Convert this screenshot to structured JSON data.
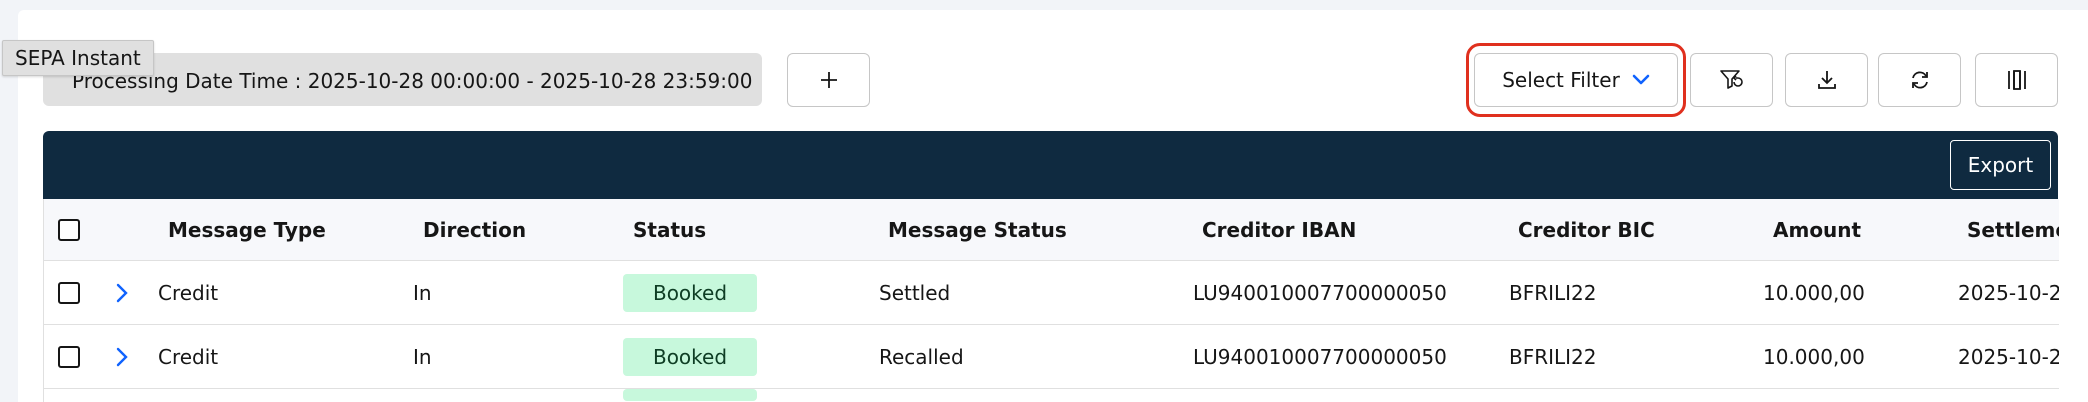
{
  "tooltip": "SEPA Instant",
  "filter_chip": "Processing Date Time : 2025-10-28 00:00:00 - 2025-10-28 23:59:00",
  "toolbar": {
    "add_icon": "plus-icon",
    "select_filter_label": "Select Filter",
    "icons": [
      "filter-reset-icon",
      "download-icon",
      "refresh-icon",
      "columns-icon"
    ]
  },
  "table": {
    "export_label": "Export",
    "columns": [
      "Message Type",
      "Direction",
      "Status",
      "Message Status",
      "Creditor IBAN",
      "Creditor BIC",
      "Amount",
      "Settleme"
    ],
    "rows": [
      {
        "message_type": "Credit",
        "direction": "In",
        "status": "Booked",
        "message_status": "Settled",
        "creditor_iban": "LU940010007700000050",
        "creditor_bic": "BFRILI22",
        "amount": "10.000,00",
        "settlement": "2025-10-2"
      },
      {
        "message_type": "Credit",
        "direction": "In",
        "status": "Booked",
        "message_status": "Recalled",
        "creditor_iban": "LU940010007700000050",
        "creditor_bic": "BFRILI22",
        "amount": "10.000,00",
        "settlement": "2025-10-2"
      }
    ]
  },
  "colors": {
    "header_bar": "#0f2a40",
    "badge_bg": "#c7f8dc",
    "highlight": "#e0301e",
    "chevron": "#0f62fe"
  }
}
